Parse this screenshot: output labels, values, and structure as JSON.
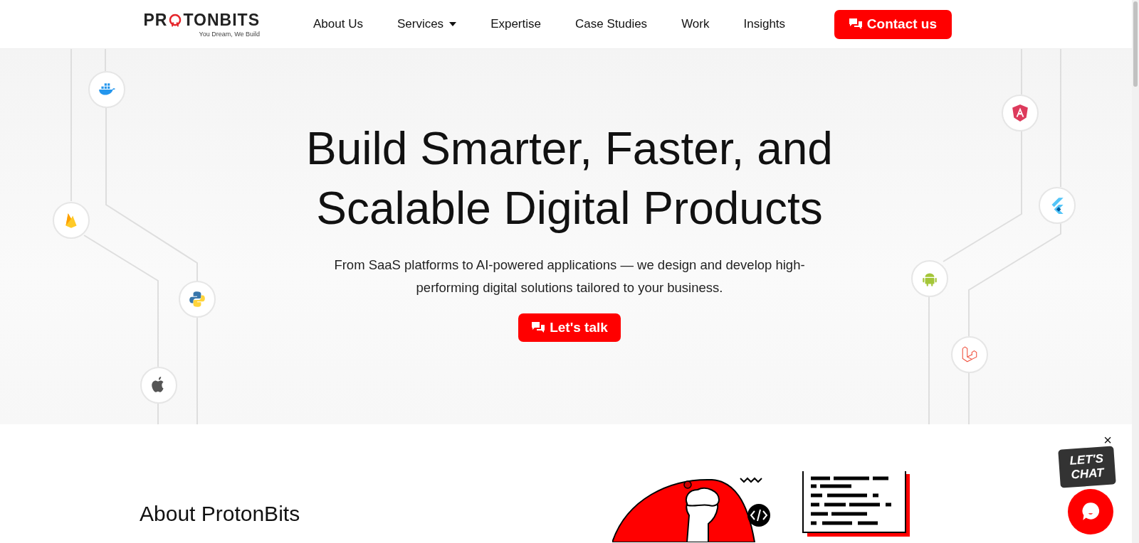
{
  "logo": {
    "before": "PR",
    "after": "TONBITS",
    "tagline": "You Dream, We Build"
  },
  "nav": [
    {
      "label": "About Us",
      "dropdown": false
    },
    {
      "label": "Services",
      "dropdown": true
    },
    {
      "label": "Expertise",
      "dropdown": false
    },
    {
      "label": "Case Studies",
      "dropdown": false
    },
    {
      "label": "Work",
      "dropdown": false
    },
    {
      "label": "Insights",
      "dropdown": false
    }
  ],
  "contact_button": "Contact us",
  "hero": {
    "title_lines": [
      "Build Smarter, Faster, and",
      "Scalable Digital Products"
    ],
    "subtitle": "From SaaS platforms to AI-powered applications — we design and develop high-performing digital solutions tailored to your business.",
    "cta": "Let's talk"
  },
  "tech_icons": [
    {
      "kind": "docker"
    },
    {
      "kind": "firebase"
    },
    {
      "kind": "python"
    },
    {
      "kind": "apple"
    },
    {
      "kind": "angular"
    },
    {
      "kind": "flutter"
    },
    {
      "kind": "android"
    },
    {
      "kind": "laravel"
    }
  ],
  "about": {
    "title": "About ProtonBits"
  },
  "chat": {
    "close": "×",
    "badge_lines": [
      "LET'S",
      "CHAT"
    ]
  }
}
